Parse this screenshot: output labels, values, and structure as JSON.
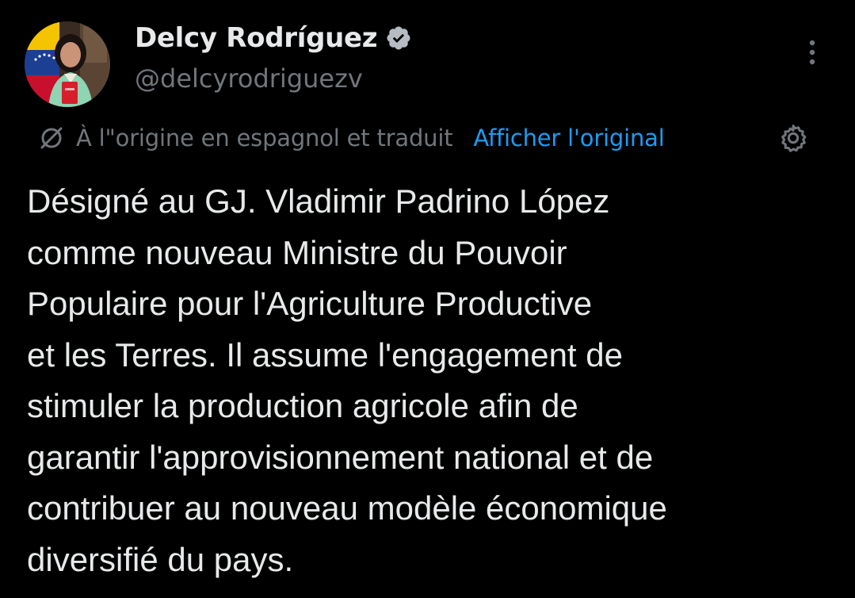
{
  "author": {
    "display_name": "Delcy Rodríguez",
    "handle": "@delcyrodriguezv",
    "verified": true
  },
  "translation": {
    "notice": "À l\"origine en espagnol et traduit",
    "show_original": "Afficher l'original"
  },
  "tweet": {
    "lines": [
      "Désigné au GJ. Vladimir Padrino López",
      "comme nouveau Ministre du Pouvoir",
      "Populaire pour l'Agriculture Productive",
      "et les Terres. Il assume l'engagement de",
      "stimuler la production agricole afin de",
      "garantir l'approvisionnement national et de",
      "contribuer au nouveau modèle économique",
      "diversifié du pays."
    ]
  },
  "icons": {
    "verified": "verified-badge-icon",
    "more": "more-vertical-icon",
    "translate": "translate-icon",
    "settings": "gear-icon"
  },
  "colors": {
    "background": "#000000",
    "text": "#e7e9ea",
    "secondary": "#71767b",
    "link": "#1d9bf0"
  }
}
